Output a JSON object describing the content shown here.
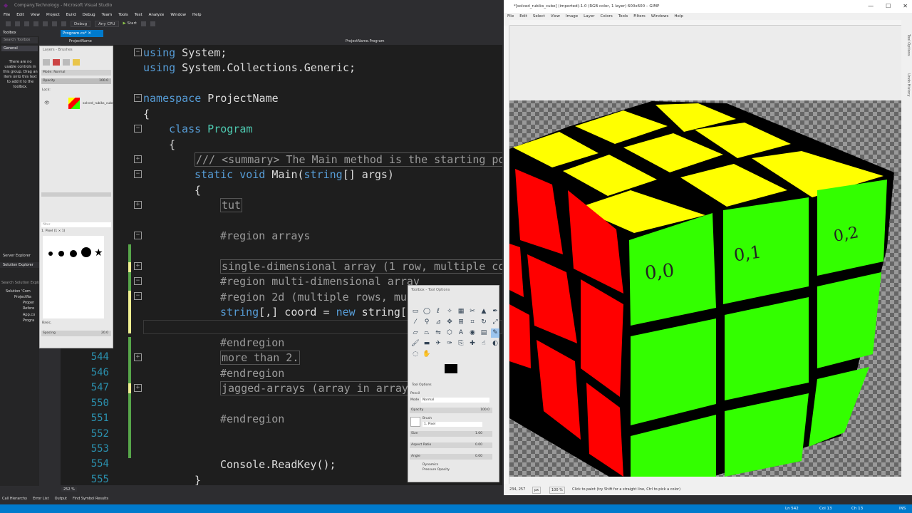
{
  "vs": {
    "window_title": "Company.Technology - Microsoft Visual Studio",
    "menu": [
      "File",
      "Edit",
      "View",
      "Project",
      "Build",
      "Debug",
      "Team",
      "Tools",
      "Test",
      "Analyze",
      "Window",
      "Help"
    ],
    "toolbar": {
      "config": "Debug",
      "platform": "Any CPU",
      "start_label": "Start"
    },
    "toolbox": {
      "title": "Toolbox",
      "search_placeholder": "Search Toolbox",
      "group": "General",
      "empty_message": "There are no usable controls in this group. Drag an item onto this text to add it to the toolbox."
    },
    "server_explorer": "Server Explorer",
    "solution_explorer": {
      "title": "Solution Explorer",
      "search_placeholder": "Search Solution Explorer",
      "items": [
        "Solution 'Com",
        "ProjectNa",
        "Proper",
        "Refere",
        "App.co",
        "Progra"
      ]
    },
    "editor_tab": "Program.cs*",
    "nav_left": "ProjectName",
    "nav_right": "ProjectName.Program",
    "code": {
      "using1_kw": "using",
      "using1_ns": " System;",
      "using2_kw": "using",
      "using2_ns": " System.Collections.Generic;",
      "ns_kw": "namespace",
      "ns_name": " ProjectName",
      "brace_open": "{",
      "class_kw": "class",
      "class_name": " Program",
      "class_brace": "{",
      "summary": "/// <summary> The Main method is the starting po",
      "main_static": "static",
      "main_void": " void",
      "main_sig": " Main(",
      "main_string": "string",
      "main_args": "[] args)",
      "main_brace": "{",
      "tut": "tut",
      "region_arrays": "#region arrays",
      "single_dim": "single-dimensional array (1 row, multiple co",
      "region_multi": "#region multi-dimensional array",
      "region_2d": "#region 2d (multiple rows, mul",
      "string_decl_type": "string",
      "string_decl_rest": "[,] coord = ",
      "string_decl_new": "new",
      "string_decl_end": " string[",
      "endregion1": "#endregion",
      "more_than_2": "more than 2.",
      "endregion2": "#endregion",
      "jagged": "jagged-arrays (array in array",
      "endregion3": "#endregion",
      "readkey": "Console.ReadKey();",
      "close_brace": "}"
    },
    "line_numbers": [
      "544",
      "546",
      "547",
      "550",
      "551",
      "552",
      "553",
      "554",
      "555"
    ],
    "zoom": "252 %",
    "bottom_tabs": [
      "Call Hierarchy",
      "Error List",
      "Output",
      "Find Symbol Results"
    ],
    "status": {
      "ln": "Ln 542",
      "col": "Col 13",
      "ch": "Ch 13",
      "ins": "INS"
    }
  },
  "gimp": {
    "window_title": "*[solved_rubiks_cube] (imported)-1.0 (RGB color, 1 layer) 600x600 – GIMP",
    "menu": [
      "File",
      "Edit",
      "Select",
      "View",
      "Image",
      "Layer",
      "Colors",
      "Tools",
      "Filters",
      "Windows",
      "Help"
    ],
    "layers_dialog": {
      "title": "Layers - Brushes",
      "mode_label": "Mode: Normal",
      "opacity_label": "Opacity",
      "opacity_value": "100.0",
      "lock_label": "Lock:",
      "layer_name": "solved_rubiks_cube",
      "filter_placeholder": "filter",
      "brush_name": "1. Pixel (1 × 1)",
      "basic_label": "Basic,",
      "spacing_label": "Spacing",
      "spacing_value": "20.0"
    },
    "tool_dialog": {
      "title": "Toolbox - Tool Options",
      "tab_label": "Tool Options",
      "tool_name": "Pencil",
      "mode_label": "Mode",
      "mode_value": "Normal",
      "opacity_label": "Opacity",
      "opacity_value": "100.0",
      "brush_label": "Brush",
      "brush_value": "1. Pixel",
      "size_label": "Size",
      "size_value": "1.00",
      "aspect_label": "Aspect Ratio",
      "aspect_value": "0.00",
      "angle_label": "Angle",
      "angle_value": "0.00",
      "dynamics_label": "Dynamics",
      "dynamics_value": "Pressure Opacity",
      "fg_color": "#000000"
    },
    "annotations": [
      "0,0",
      "0,1",
      "0,2"
    ],
    "status": {
      "coords": "234, 257",
      "unit": "px",
      "zoom": "100 %",
      "hint": "Click to paint (try Shift for a straight line, Ctrl to pick a color)"
    },
    "right_dock_labels": [
      "Tool Options",
      "Undo History"
    ]
  },
  "colors": {
    "cube_yellow": "#ffff00",
    "cube_red": "#ff0000",
    "cube_green": "#33ff00",
    "vs_accent": "#007acc"
  }
}
